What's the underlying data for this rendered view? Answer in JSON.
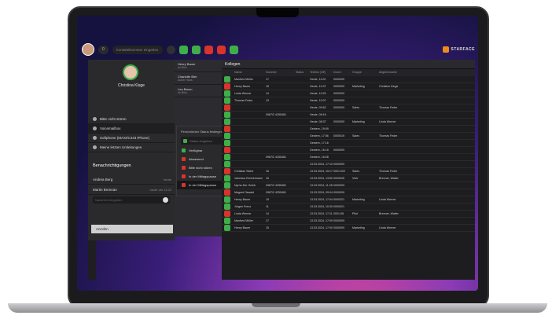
{
  "topbar": {
    "pill_label": "0",
    "search_placeholder": "Kontakt/Nummer eingeben",
    "brand": "STARFACE"
  },
  "profile": {
    "name": "Christina Kluge"
  },
  "left_menu": [
    {
      "label": "Bitte nicht stören"
    },
    {
      "label": "Voicemailbox"
    },
    {
      "label": "Softphone (MAXI/C443 iPhone)"
    },
    {
      "label": "Meine letzten Umleitungen"
    }
  ],
  "notifications": {
    "title": "Benachrichtigungen",
    "items": [
      {
        "name": "Andrea Berg",
        "time": "heute"
      },
      {
        "name": "Martin Brennan",
        "time": "heute um 11:22"
      }
    ],
    "input_placeholder": "Nachricht eingeben"
  },
  "dial_button": "Anrufen",
  "mid_contacts": [
    {
      "name": "Henry Bauer",
      "status": "Im Büro"
    },
    {
      "name": "Charlotte Bier",
      "status": "Außer Haus"
    },
    {
      "name": "Lea Baron",
      "status": "Im Büro"
    }
  ],
  "status_card": {
    "label": "Persönlichen Status festlegen",
    "select_placeholder": "Status eingeben",
    "options": [
      {
        "label": "Verfügbar",
        "color": "#3fae49"
      },
      {
        "label": "Abwesend",
        "color": "#d9342b"
      },
      {
        "label": "Bitte nicht stören",
        "color": "#d9342b"
      },
      {
        "label": "In der Mittagspause",
        "color": "#d9342b"
      },
      {
        "label": "In der Mittagspause",
        "color": "#d9342b"
      }
    ]
  },
  "main": {
    "title": "Kollegen",
    "columns": [
      "",
      "Name",
      "Nummer",
      "Status",
      "Telefon (Off)",
      "Durch",
      "Gruppe",
      "Abgleichname",
      ""
    ],
    "rows": [
      [
        "",
        "Manfred Müller",
        "17",
        "",
        "Heute, 11:02",
        "0000009",
        "",
        "",
        ""
      ],
      [
        "",
        "Henry Bauer",
        "15",
        "",
        "Heute, 10:37",
        "0000009",
        "Marketing",
        "Christine Kluge",
        ""
      ],
      [
        "",
        "Linda Werner",
        "14",
        "",
        "Heute, 10:20",
        "0000009",
        "",
        "",
        ""
      ],
      [
        "",
        "Thomas Feder",
        "13",
        "",
        "Heute, 10:07",
        "0000009",
        "",
        "",
        ""
      ],
      [
        "",
        "",
        "",
        "",
        "Heute, 09:52",
        "0000009",
        "Sales",
        "Thomas Feder",
        ""
      ],
      [
        "",
        "",
        "0987/2 4255481",
        "",
        "Heute, 09:16",
        "",
        "",
        "",
        ""
      ],
      [
        "",
        "",
        "",
        "",
        "Heute, 08:37",
        "0000009",
        "Marketing",
        "Linda Werner",
        ""
      ],
      [
        "",
        "",
        "",
        "",
        "Gestern, 19:09",
        "",
        "",
        "",
        ""
      ],
      [
        "",
        "",
        "",
        "",
        "Gestern, 17:56",
        "0000019",
        "Sales",
        "Thomas Feder",
        ""
      ],
      [
        "",
        "",
        "",
        "",
        "Gestern, 17:16",
        "",
        "",
        "",
        ""
      ],
      [
        "",
        "",
        "",
        "",
        "Gestern, 16:18",
        "0000009",
        "",
        "",
        ""
      ],
      [
        "",
        "",
        "0987/2 4255481",
        "",
        "Gestern, 16:08",
        "",
        "",
        "",
        ""
      ],
      [
        "",
        "",
        "",
        "",
        "13.03.2024, 17:10",
        "0000009",
        "",
        "",
        ""
      ],
      [
        "",
        "Christian Siebe",
        "16",
        "",
        "13.03.2024, 15:17",
        "0001:022",
        "Sales",
        "Thomas Feder",
        ""
      ],
      [
        "",
        "Vanessa Zimmermann",
        "16",
        "",
        "13.03.2024, 13:50",
        "0000026",
        "Vertr",
        "Brenner, Walter",
        ""
      ],
      [
        "",
        "Nyrhe-Der Gmbh",
        "0987/2 4255481",
        "",
        "13.03.2024, 11:28",
        "0000009",
        "",
        "",
        ""
      ],
      [
        "",
        "Magnet Oswald",
        "0987/2 4255481",
        "",
        "13.03.2024, 09:04",
        "0000009",
        "",
        "",
        ""
      ],
      [
        "",
        "Henry Bauer",
        "15",
        "",
        "13.03.2024, 17:04",
        "0000321",
        "Marketing",
        "Linda Werner",
        ""
      ],
      [
        "",
        "Jürgen Frenz",
        "11",
        "",
        "13.03.2024, 10:30",
        "0000021",
        "",
        "",
        ""
      ],
      [
        "",
        "Linda Werner",
        "14",
        "",
        "13.03.2024, 17:11",
        "0001:08",
        "Pilot",
        "Brenner, Walter",
        ""
      ],
      [
        "",
        "Manfred Müller",
        "17",
        "",
        "13.03.2024, 17:09",
        "0000009",
        "",
        "",
        ""
      ],
      [
        "",
        "Henry Bauer",
        "15",
        "",
        "13.03.2024, 17:00",
        "0000009",
        "Marketing",
        "Linda Werner",
        ""
      ]
    ]
  },
  "call_line": "Weiterleitung (+49 721 12341243)"
}
